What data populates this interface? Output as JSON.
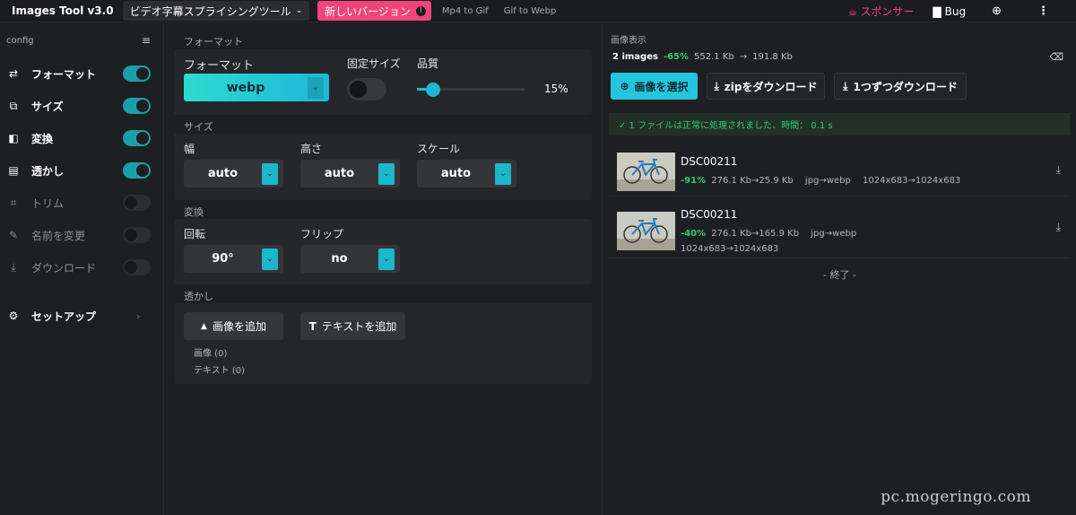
{
  "topbar": {
    "brand": "Images Tool v3.0",
    "tool_select": "ビデオ字幕スプライシングツール",
    "new_version": "新しいバージョン",
    "links": [
      "Mp4 to Gif",
      "Gif to Webp"
    ],
    "sponsor": "スポンサー",
    "bug": "Bug"
  },
  "sidebar": {
    "config_label": "config",
    "items": [
      {
        "label": "フォーマット",
        "icon": "swap-icon",
        "enabled": true
      },
      {
        "label": "サイズ",
        "icon": "crop-resize-icon",
        "enabled": true
      },
      {
        "label": "変換",
        "icon": "flip-icon",
        "enabled": true
      },
      {
        "label": "透かし",
        "icon": "watermark-icon",
        "enabled": true
      },
      {
        "label": "トリム",
        "icon": "crop-icon",
        "enabled": false
      },
      {
        "label": "名前を変更",
        "icon": "rename-icon",
        "enabled": false
      },
      {
        "label": "ダウンロード",
        "icon": "download-icon",
        "enabled": false
      }
    ],
    "setup": "セットアップ"
  },
  "format": {
    "section": "フォーマット",
    "format_label": "フォーマット",
    "format_value": "webp",
    "fixed_size_label": "固定サイズ",
    "fixed_size_on": false,
    "quality_label": "品質",
    "quality_value": "15%",
    "quality_fraction": 0.15
  },
  "size": {
    "section": "サイズ",
    "width_label": "幅",
    "width_value": "auto",
    "height_label": "高さ",
    "height_value": "auto",
    "scale_label": "スケール",
    "scale_value": "auto"
  },
  "transform": {
    "section": "変換",
    "rotate_label": "回転",
    "rotate_value": "90°",
    "flip_label": "フリップ",
    "flip_value": "no"
  },
  "watermark": {
    "section": "透かし",
    "add_image": "画像を追加",
    "add_text": "テキストを追加",
    "image_count": "画像 (0)",
    "text_count": "テキスト (0)"
  },
  "preview": {
    "title": "画像表示",
    "count": "2 images",
    "total_pct": "-65%",
    "total_from": "552.1 Kb",
    "total_to": "191.8 Kb",
    "select_btn": "画像を選択",
    "zip_btn": "zipをダウンロード",
    "each_btn": "1つずつダウンロード",
    "success": "✓ 1 ファイルは正常に処理されました、時間： 0.1 s",
    "files": [
      {
        "name": "DSC00211",
        "pct": "-91%",
        "sizes": "276.1 Kb→25.9 Kb",
        "conv": "jpg→webp",
        "dims": "1024x683→1024x683"
      },
      {
        "name": "DSC00211",
        "pct": "-40%",
        "sizes": "276.1 Kb→165.9 Kb",
        "conv": "jpg→webp",
        "dims": "1024x683→1024x683"
      }
    ],
    "end": "- 終了 -"
  },
  "watermark_text": "pc.mogeringo.com",
  "colors": {
    "accent": "#1bb7d6",
    "pink": "#f0457c",
    "green": "#2ecc71"
  }
}
